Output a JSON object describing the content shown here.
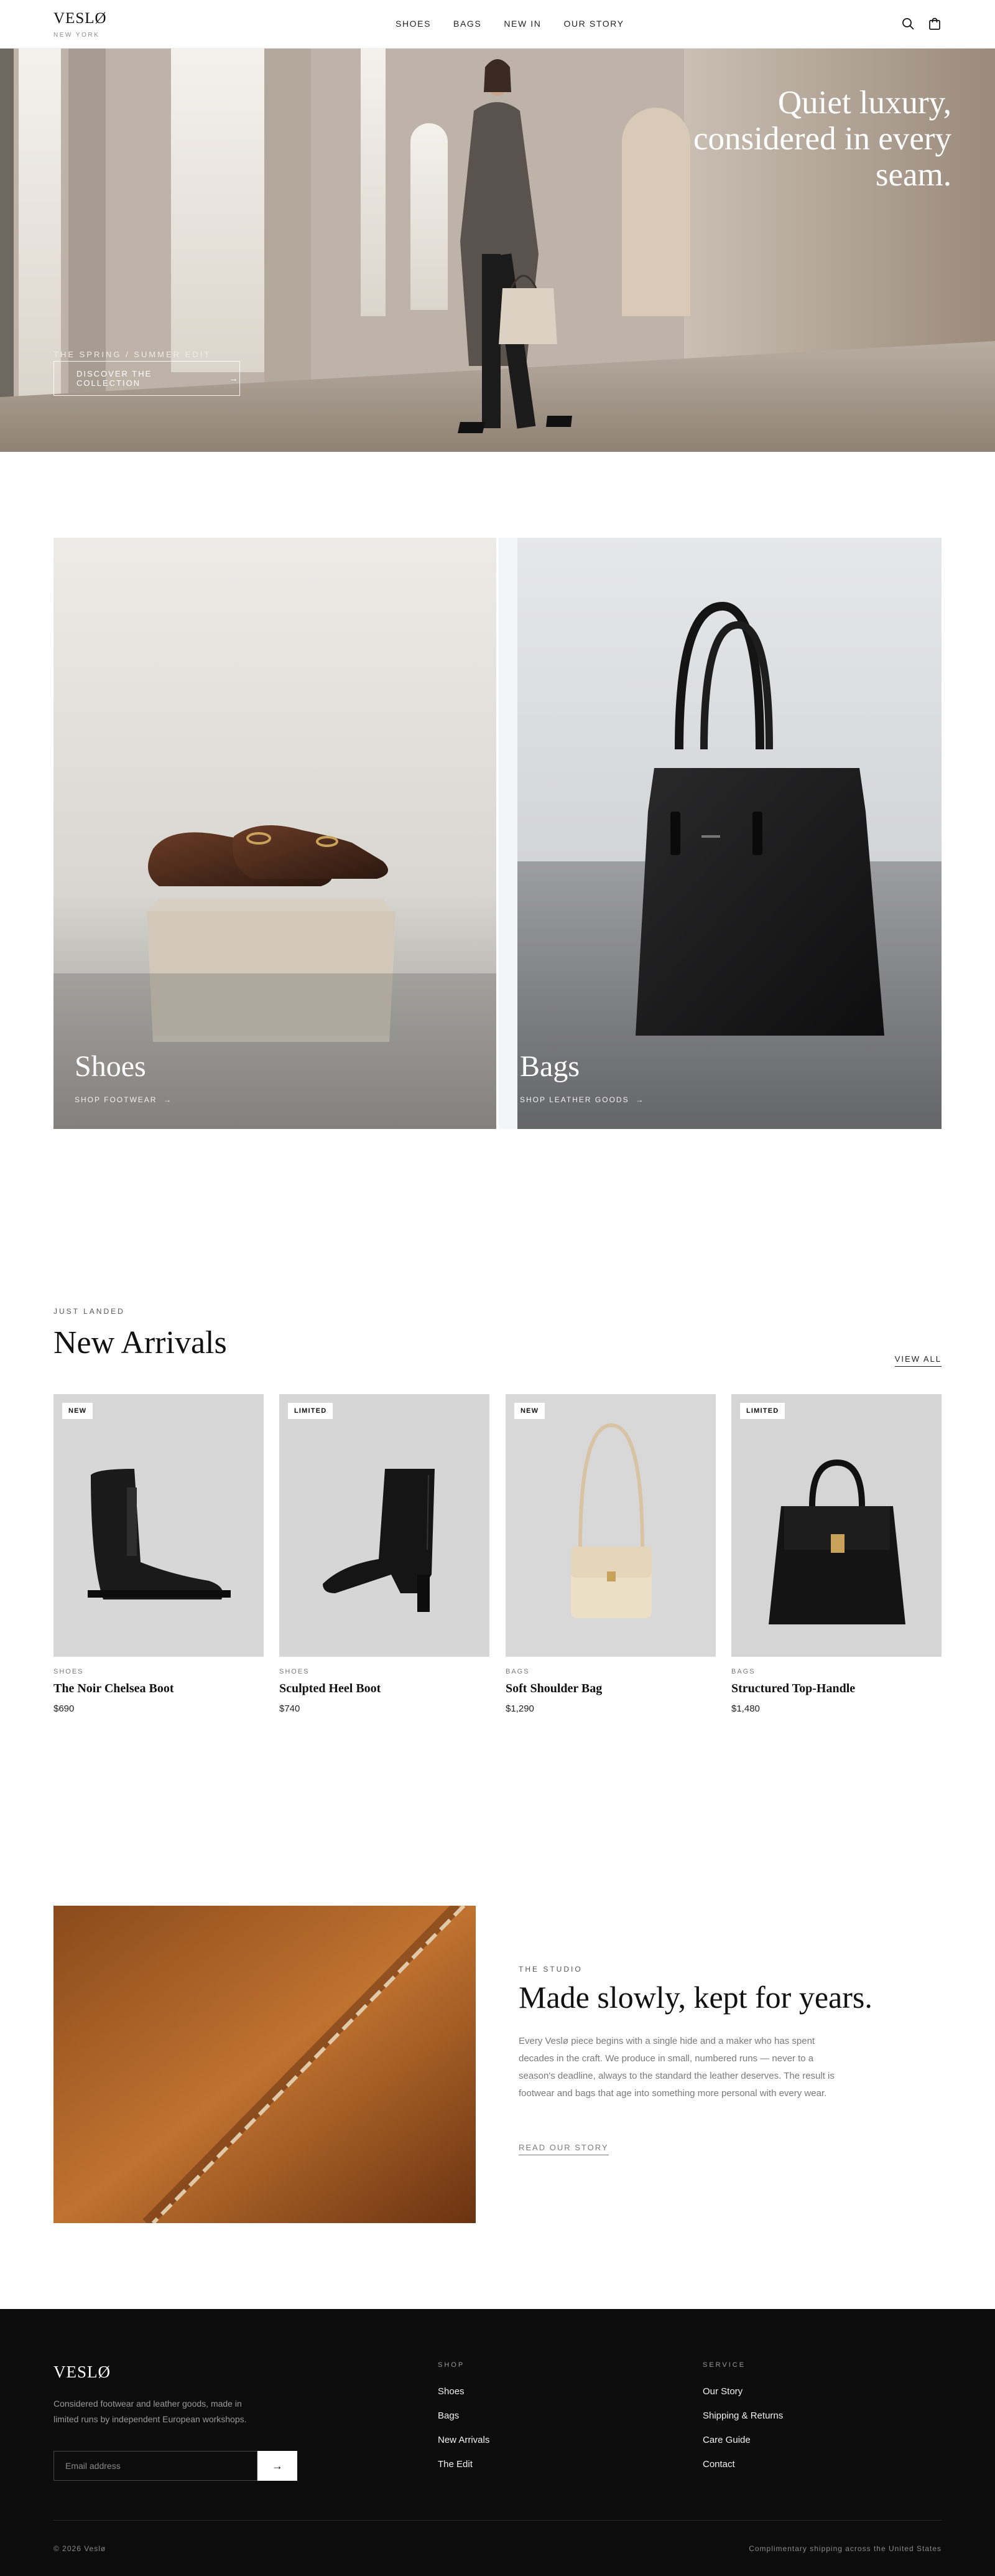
{
  "header": {
    "logo": "VESLØ",
    "logo_sub": "NEW YORK",
    "nav": [
      "SHOES",
      "BAGS",
      "NEW IN",
      "OUR STORY"
    ],
    "icons": [
      "search-icon",
      "bag-icon"
    ]
  },
  "hero": {
    "title_lines": [
      "Quiet luxury,",
      "considered in every",
      "seam."
    ],
    "eyebrow": "THE SPRING / SUMMER EDIT",
    "cta": "DISCOVER THE COLLECTION"
  },
  "categories": [
    {
      "title": "Shoes",
      "link": "SHOP FOOTWEAR"
    },
    {
      "title": "Bags",
      "link": "SHOP LEATHER GOODS"
    }
  ],
  "arrivals": {
    "eyebrow": "JUST LANDED",
    "title": "New Arrivals",
    "view_all": "VIEW ALL",
    "products": [
      {
        "badge": "NEW",
        "category": "SHOES",
        "name": "The Noir Chelsea Boot",
        "price": "$690"
      },
      {
        "badge": "LIMITED",
        "category": "SHOES",
        "name": "Sculpted Heel Boot",
        "price": "$740"
      },
      {
        "badge": "NEW",
        "category": "BAGS",
        "name": "Soft Shoulder Bag",
        "price": "$1,290"
      },
      {
        "badge": "LIMITED",
        "category": "BAGS",
        "name": "Structured Top-Handle",
        "price": "$1,480"
      }
    ]
  },
  "story": {
    "eyebrow": "THE STUDIO",
    "title": "Made slowly, kept for years.",
    "body": "Every Veslø piece begins with a single hide and a maker who has spent decades in the craft. We produce in small, numbered runs — never to a season's deadline, always to the standard the leather deserves. The result is footwear and bags that age into something more personal with every wear.",
    "link": "READ OUR STORY"
  },
  "footer": {
    "logo": "VESLØ",
    "description": "Considered footwear and leather goods, made in limited runs by independent European workshops.",
    "email_placeholder": "Email address",
    "shop_head": "SHOP",
    "shop_links": [
      "Shoes",
      "Bags",
      "New Arrivals",
      "The Edit"
    ],
    "service_head": "SERVICE",
    "service_links": [
      "Our Story",
      "Shipping & Returns",
      "Care Guide",
      "Contact"
    ],
    "copyright": "© 2026 Veslø",
    "shipping_note": "Complimentary shipping across the United States"
  },
  "colors": {
    "accent": "#111111",
    "footer_bg": "#0c0c0c",
    "leather": "#a65c25"
  }
}
